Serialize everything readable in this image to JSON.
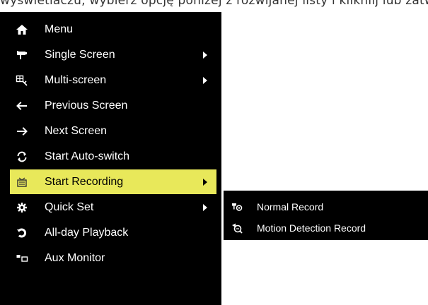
{
  "top_text": "wyświetlaczu, wybierz opcję poniżej z rozwijanej listy i klikniij lub zatwierdź przyciskiem",
  "menu": {
    "items": [
      {
        "label": "Menu",
        "icon": "home-icon",
        "submenu": false
      },
      {
        "label": "Single Screen",
        "icon": "camera-icon",
        "submenu": true
      },
      {
        "label": "Multi-screen",
        "icon": "multi-screen-icon",
        "submenu": true
      },
      {
        "label": "Previous Screen",
        "icon": "arrow-left-icon",
        "submenu": false
      },
      {
        "label": "Next Screen",
        "icon": "arrow-right-icon",
        "submenu": false
      },
      {
        "label": "Start Auto-switch",
        "icon": "cycle-icon",
        "submenu": false
      },
      {
        "label": "Start Recording",
        "icon": "recording-icon",
        "submenu": true,
        "selected": true
      },
      {
        "label": "Quick Set",
        "icon": "gear-icon",
        "submenu": true
      },
      {
        "label": "All-day Playback",
        "icon": "playback-icon",
        "submenu": false
      },
      {
        "label": "Aux Monitor",
        "icon": "aux-monitor-icon",
        "submenu": false
      }
    ]
  },
  "submenu": {
    "items": [
      {
        "label": "Normal Record",
        "icon": "normal-record-icon"
      },
      {
        "label": "Motion Detection Record",
        "icon": "motion-record-icon"
      }
    ]
  },
  "colors": {
    "menu_background": "#000000",
    "selected_highlight": "#e8e85a",
    "text": "#ffffff"
  }
}
